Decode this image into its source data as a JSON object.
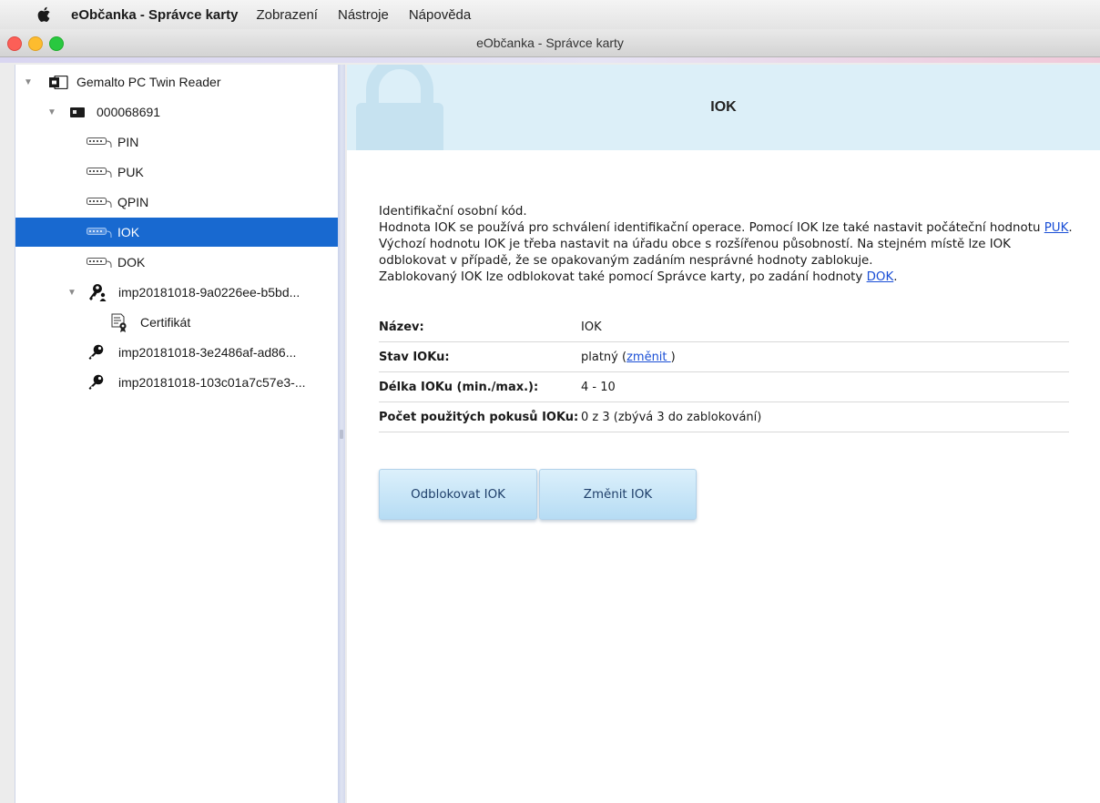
{
  "menubar": {
    "app_name": "eObčanka - Správce karty",
    "items": [
      "Zobrazení",
      "Nástroje",
      "Nápověda"
    ]
  },
  "window": {
    "title": "eObčanka - Správce karty"
  },
  "sidebar": {
    "reader": "Gemalto PC Twin Reader",
    "card": "000068691",
    "items": [
      {
        "label": "PIN",
        "icon": "keypad-icon"
      },
      {
        "label": "PUK",
        "icon": "keypad-icon"
      },
      {
        "label": "QPIN",
        "icon": "keypad-icon"
      },
      {
        "label": "IOK",
        "icon": "keypad-icon",
        "selected": true
      },
      {
        "label": "DOK",
        "icon": "keypad-icon"
      }
    ],
    "keys": [
      {
        "label": "imp20181018-9a0226ee-b5bd...",
        "icon": "key-person-icon",
        "expanded": true,
        "child": "Certifikát"
      },
      {
        "label": "imp20181018-3e2486af-ad86...",
        "icon": "key-icon"
      },
      {
        "label": "imp20181018-103c01a7c57e3-...",
        "icon": "key-icon"
      }
    ]
  },
  "main": {
    "title": "IOK",
    "description": {
      "line1": "Identifikační osobní kód.",
      "line2_prefix": "Hodnota IOK se používá pro schválení identifikační operace. Pomocí IOK lze také nastavit počáteční hodnotu ",
      "line2_link": "PUK",
      "line2_suffix": ".",
      "line3": "Výchozí hodnotu IOK je třeba nastavit na úřadu obce s rozšířenou působností. Na stejném místě lze IOK",
      "line4": "odblokovat v případě, že se opakovaným zadáním nesprávné hodnoty zablokuje.",
      "line5_prefix": "Zablokovaný IOK lze odblokovat také pomocí Správce karty, po zadání hodnoty ",
      "line5_link": "DOK",
      "line5_suffix": "."
    },
    "properties": {
      "name_label": "Název:",
      "name_value": "IOK",
      "state_label": "Stav IOKu:",
      "state_value": "platný (",
      "state_link": "změnit ",
      "state_close": ")",
      "length_label": "Délka IOKu (min./max.):",
      "length_value": "4 - 10",
      "attempts_label": "Počet použitých pokusů IOKu:",
      "attempts_value": "0 z 3 (zbývá 3 do zablokování)"
    },
    "buttons": {
      "unblock": "Odblokovat IOK",
      "change": "Změnit IOK"
    }
  }
}
